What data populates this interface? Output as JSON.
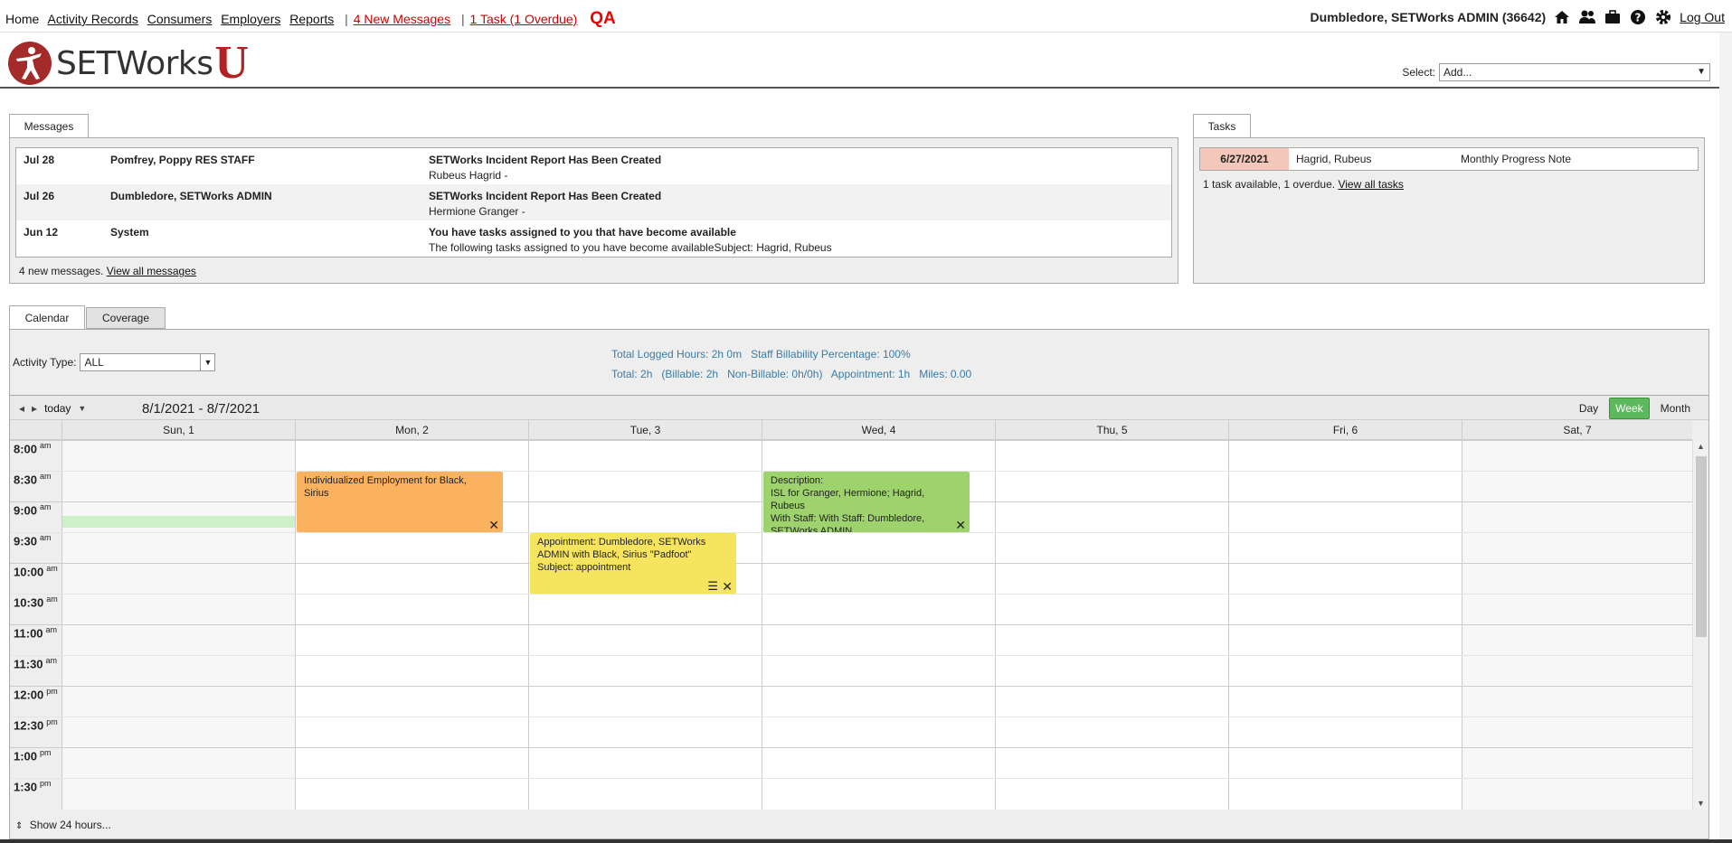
{
  "nav": {
    "home": "Home",
    "activity_records": "Activity Records",
    "consumers": "Consumers",
    "employers": "Employers",
    "reports": "Reports",
    "sep": "|",
    "new_messages": "4 New Messages",
    "tasks": "1 Task (1 Overdue)",
    "qa": "QA"
  },
  "user": {
    "name": "Dumbledore, SETWorks ADMIN (36642)",
    "logout": "Log Out"
  },
  "logo": {
    "word": "SETWorks",
    "u": "U"
  },
  "select": {
    "label": "Select:",
    "value": "Add..."
  },
  "messages": {
    "tab": "Messages",
    "rows": [
      {
        "date": "Jul 28",
        "from": "Pomfrey, Poppy RES STAFF",
        "subject": "SETWorks Incident Report Has Been Created",
        "body": "Rubeus Hagrid -"
      },
      {
        "date": "Jul 26",
        "from": "Dumbledore, SETWorks ADMIN",
        "subject": "SETWorks Incident Report Has Been Created",
        "body": "Hermione Granger -"
      },
      {
        "date": "Jun 12",
        "from": "System",
        "subject": "You have tasks assigned to you that have become available",
        "body": "The following tasks assigned to you have become availableSubject: Hagrid, Rubeus"
      }
    ],
    "footer_text": "4 new messages.",
    "footer_link": "View all messages"
  },
  "tasks": {
    "tab": "Tasks",
    "row": {
      "date": "6/27/2021",
      "who": "Hagrid, Rubeus",
      "what": "Monthly Progress Note"
    },
    "footer_text": "1 task available, 1 overdue.",
    "footer_link": "View all tasks"
  },
  "calendar": {
    "tabs": [
      "Calendar",
      "Coverage"
    ],
    "activity_type_label": "Activity Type:",
    "activity_type_value": "ALL",
    "stats_line1": "Total Logged Hours: 2h 0m   Staff Billability Percentage: 100%",
    "stats_line2": "Total: 2h   (Billable: 2h   Non-Billable: 0h/0h)   Appointment: 1h   Miles: 0.00",
    "today": "today",
    "range": "8/1/2021 - 8/7/2021",
    "views": [
      "Day",
      "Week",
      "Month"
    ],
    "active_view": "Week",
    "days": [
      "Sun, 1",
      "Mon, 2",
      "Tue, 3",
      "Wed, 4",
      "Thu, 5",
      "Fri, 6",
      "Sat, 7"
    ],
    "times": [
      {
        "t": "8:00",
        "ap": "am"
      },
      {
        "t": "8:30",
        "ap": "am"
      },
      {
        "t": "9:00",
        "ap": "am"
      },
      {
        "t": "9:30",
        "ap": "am"
      },
      {
        "t": "10:00",
        "ap": "am"
      },
      {
        "t": "10:30",
        "ap": "am"
      },
      {
        "t": "11:00",
        "ap": "am"
      },
      {
        "t": "11:30",
        "ap": "am"
      },
      {
        "t": "12:00",
        "ap": "pm"
      },
      {
        "t": "12:30",
        "ap": "pm"
      },
      {
        "t": "1:00",
        "ap": "pm"
      },
      {
        "t": "1:30",
        "ap": "pm"
      }
    ],
    "events": [
      {
        "lines": [
          "Individualized Employment for Black,",
          "Sirius"
        ],
        "color": "#fbb25e",
        "day": "Mon, 2",
        "start": "8:30 am",
        "end": "9:30 am"
      },
      {
        "lines": [
          "Description:",
          "ISL for Granger, Hermione; Hagrid,",
          "Rubeus",
          "With Staff: With Staff: Dumbledore,",
          "SETWorks ADMIN"
        ],
        "color": "#9ed26c",
        "day": "Wed, 4",
        "start": "8:30 am",
        "end": "9:30 am"
      },
      {
        "lines": [
          "Appointment: Dumbledore, SETWorks",
          "ADMIN with Black, Sirius \"Padfoot\"",
          "Subject: appointment"
        ],
        "color": "#f6e45e",
        "day": "Tue, 3",
        "start": "9:30 am",
        "end": "10:30 am"
      }
    ],
    "show_hours": "Show 24 hours..."
  }
}
